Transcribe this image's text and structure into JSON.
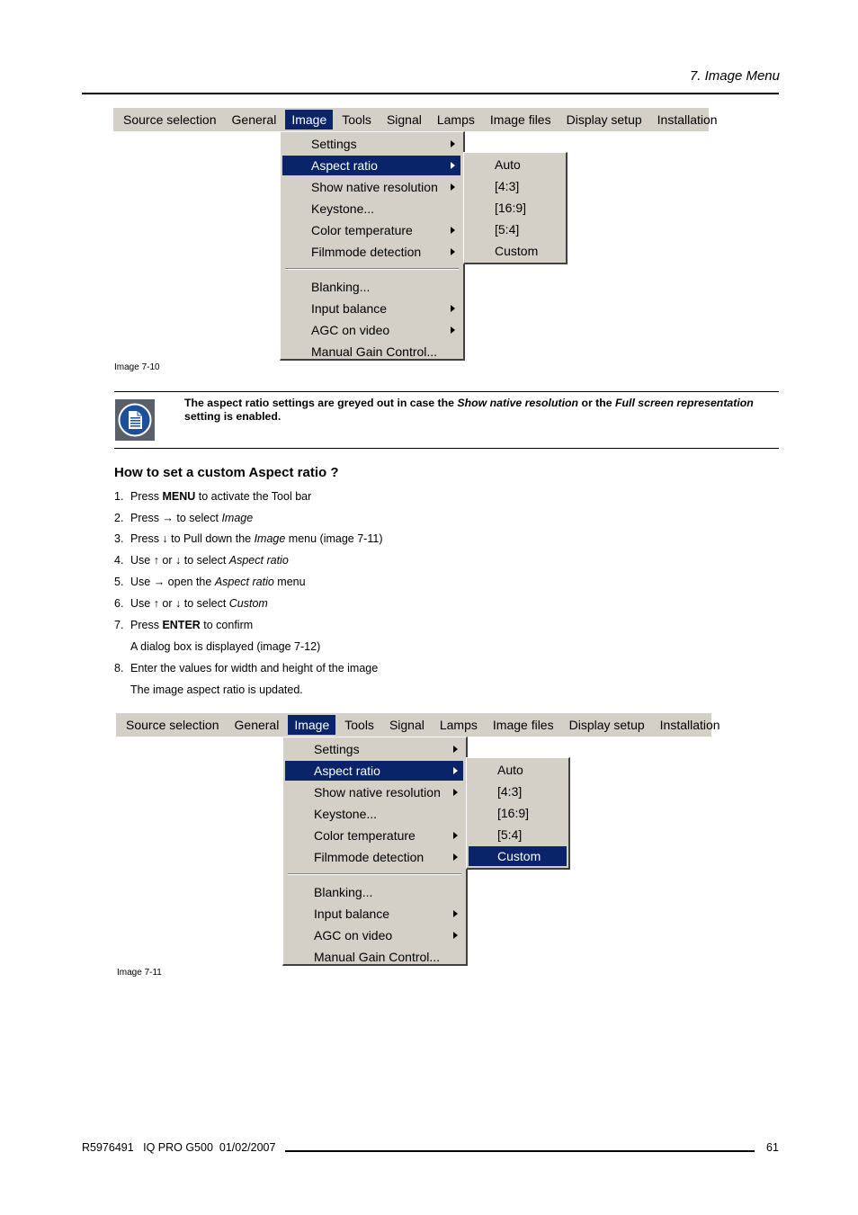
{
  "header": {
    "chapter_title": "7.  Image Menu"
  },
  "menubar_items": [
    "Source selection",
    "General",
    "Image",
    "Tools",
    "Signal",
    "Lamps",
    "Image files",
    "Display setup",
    "Installation"
  ],
  "image_menu_items": [
    {
      "label": "Settings",
      "has_submenu": true
    },
    {
      "label": "Aspect ratio",
      "has_submenu": true
    },
    {
      "label": "Show native resolution",
      "has_submenu": true
    },
    {
      "label": "Keystone...",
      "has_submenu": false
    },
    {
      "label": "Color temperature",
      "has_submenu": true
    },
    {
      "label": "Filmmode detection",
      "has_submenu": true
    },
    {
      "label": "Blanking...",
      "has_submenu": false
    },
    {
      "label": "Input balance",
      "has_submenu": true
    },
    {
      "label": "AGC on video",
      "has_submenu": true
    },
    {
      "label": "Manual Gain Control...",
      "has_submenu": false
    }
  ],
  "aspect_ratio_options": [
    "Auto",
    "[4:3]",
    "[16:9]",
    "[5:4]",
    "Custom"
  ],
  "figure1": {
    "active_menu": "Image",
    "highlighted_item": "Aspect ratio",
    "highlighted_sub": null,
    "caption": "Image 7-10"
  },
  "figure2": {
    "active_menu": "Image",
    "highlighted_item": "Aspect ratio",
    "highlighted_sub": "Custom",
    "caption": "Image 7-11"
  },
  "note": {
    "icon": "document-note-icon",
    "part1": "The aspect ratio settings are greyed out in case the ",
    "em1": "Show native resolution",
    "part2": " or the ",
    "em2": "Full screen representation",
    "part3": " setting is enabled."
  },
  "section_title": "How to set a custom Aspect ratio ?",
  "steps": [
    {
      "num": "1.",
      "pre": "Press ",
      "bold": "MENU",
      "mid": " to activate the Tool bar",
      "em": "",
      "post": ""
    },
    {
      "num": "2.",
      "pre": "Press → to select ",
      "bold": "",
      "mid": "",
      "em": "Image",
      "post": ""
    },
    {
      "num": "3.",
      "pre": "Press ↓ to Pull down the ",
      "bold": "",
      "mid": "",
      "em": "Image",
      "post": " menu (image 7-11)"
    },
    {
      "num": "4.",
      "pre": "Use ↑ or ↓ to select ",
      "bold": "",
      "mid": "",
      "em": "Aspect ratio",
      "post": ""
    },
    {
      "num": "5.",
      "pre": "Use → open the ",
      "bold": "",
      "mid": "",
      "em": "Aspect ratio",
      "post": " menu"
    },
    {
      "num": "6.",
      "pre": "Use ↑ or ↓ to select ",
      "bold": "",
      "mid": "",
      "em": "Custom",
      "post": ""
    },
    {
      "num": "7.",
      "pre": "Press ",
      "bold": "ENTER",
      "mid": " to confirm",
      "em": "",
      "post": ""
    },
    {
      "num": "",
      "pre": "A dialog box is displayed (image 7-12)",
      "bold": "",
      "mid": "",
      "em": "",
      "post": ""
    },
    {
      "num": "8.",
      "pre": "Enter the values for width and height of the image",
      "bold": "",
      "mid": "",
      "em": "",
      "post": ""
    },
    {
      "num": "",
      "pre": "The image aspect ratio is updated.",
      "bold": "",
      "mid": "",
      "em": "",
      "post": ""
    }
  ],
  "footer": {
    "doc_info": "R5976491   IQ PRO G500  01/02/2007",
    "page_number": "61"
  }
}
